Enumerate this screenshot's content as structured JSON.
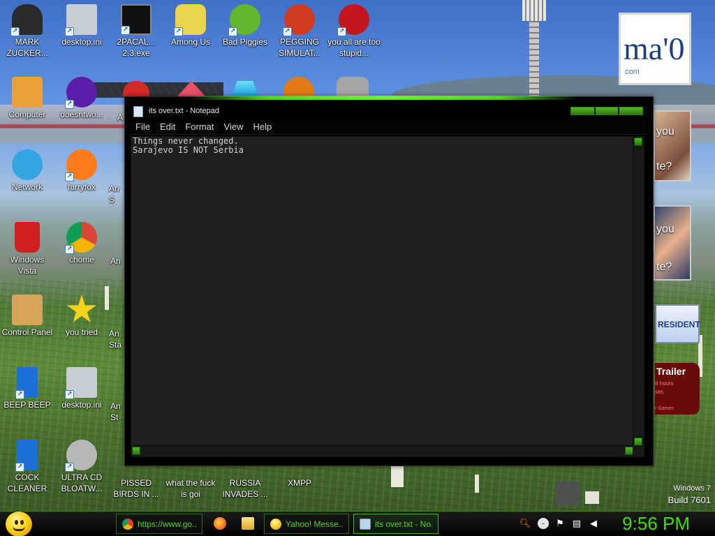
{
  "desktop": {
    "icons": [
      {
        "label": "MARK ZUCKER...",
        "icon": "person-icon",
        "color": "#2a2a2a"
      },
      {
        "label": "desktop.ini",
        "icon": "settings-file-icon",
        "color": "#c7cdd4"
      },
      {
        "label": "2PACAL... 2.3.exe",
        "icon": "console-icon",
        "color": "#111111"
      },
      {
        "label": "Among Us",
        "icon": "among-us-icon",
        "color": "#e8d54a"
      },
      {
        "label": "Bad Piggies",
        "icon": "pig-icon",
        "color": "#62b82b"
      },
      {
        "label": "PEGGING SIMULAT...",
        "icon": "p-logo-icon",
        "color": "#d03a1e"
      },
      {
        "label": "you all are too stupid...",
        "icon": "devcpp-icon",
        "color": "#c4161c"
      },
      {
        "label": "Computer",
        "icon": "computer-icon",
        "color": "#e9a23b"
      },
      {
        "label": "doesntwo...",
        "icon": "yahoo-icon",
        "color": "#5a1eaa"
      },
      {
        "label": "Network",
        "icon": "network-icon",
        "color": "#35a5e0"
      },
      {
        "label": "furryfox",
        "icon": "firefox-icon",
        "color": "#ff7a1a"
      },
      {
        "label": "Windows Vista",
        "icon": "recycle-bin-icon",
        "color": "#d21f1f"
      },
      {
        "label": "chome",
        "icon": "chrome-icon",
        "color": "#2d9a45"
      },
      {
        "label": "Control Panel",
        "icon": "control-panel-icon",
        "color": "#d7a55a"
      },
      {
        "label": "you tried",
        "icon": "star-icon",
        "color": "#f2d21b"
      },
      {
        "label": "BEEP BEEP",
        "icon": "blue-file-icon",
        "color": "#1b6fd6"
      },
      {
        "label": "desktop.ini",
        "icon": "settings-file-icon",
        "color": "#c7cdd4"
      },
      {
        "label": "COCK CLEANER",
        "icon": "blue-file-icon",
        "color": "#1b6fd6"
      },
      {
        "label": "ULTRA CD BLOATW...",
        "icon": "cd-icon",
        "color": "#b7b7b7"
      },
      {
        "label": "PISSED BIRDS IN ...",
        "icon": "angry-bird-icon",
        "color": "#d82b2b"
      },
      {
        "label": "what the fuck is goi",
        "icon": "unknown-icon",
        "color": "#7fa45a"
      },
      {
        "label": "RUSSIA INVADES ...",
        "icon": "unknown-icon",
        "color": "#d83a1a"
      },
      {
        "label": "XMPP",
        "icon": "xmpp-icon",
        "color": "#e86b12"
      }
    ],
    "partial_labels": [
      "A",
      "An S",
      "An",
      "An Sta",
      "An St"
    ],
    "brand": {
      "line1": "Windows 7",
      "line2": "Build 7601"
    }
  },
  "gadgets": {
    "mao_logo": {
      "text": "ma'0",
      "sub": "com"
    },
    "photo1_text": [
      "you",
      "te?"
    ],
    "photo2_text": [
      "you",
      "te?"
    ],
    "president": "RESIDENT",
    "trailer": {
      "title": "Trailer",
      "line1": "8 hours",
      "line2": "sec",
      "line3": "r Games"
    }
  },
  "window": {
    "title": "its over.txt - Notepad",
    "menu": [
      "File",
      "Edit",
      "Format",
      "View",
      "Help"
    ],
    "content": "Things never changed.\nSarajevo IS NOT Serbia",
    "accent": "#4fb91f"
  },
  "taskbar": {
    "buttons": [
      {
        "label": "https://www.go...",
        "icon": "chrome-icon",
        "color": "#2d9a45",
        "active": false
      },
      {
        "label": "Yahoo! Messe...",
        "icon": "yahoo-icon",
        "color": "#f2c71b",
        "active": false
      },
      {
        "label": "its over.txt - No...",
        "icon": "notepad-icon",
        "color": "#bcd3ee",
        "active": true
      }
    ],
    "pinned": [
      {
        "icon": "firefox-icon",
        "color": "#ff7a1a"
      },
      {
        "icon": "folder-icon",
        "color": "#f0c24a"
      }
    ],
    "tray": [
      "search-icon",
      "messenger-icon",
      "action-center-flag-icon",
      "network-icon",
      "volume-icon"
    ],
    "clock": "9:56 PM"
  }
}
